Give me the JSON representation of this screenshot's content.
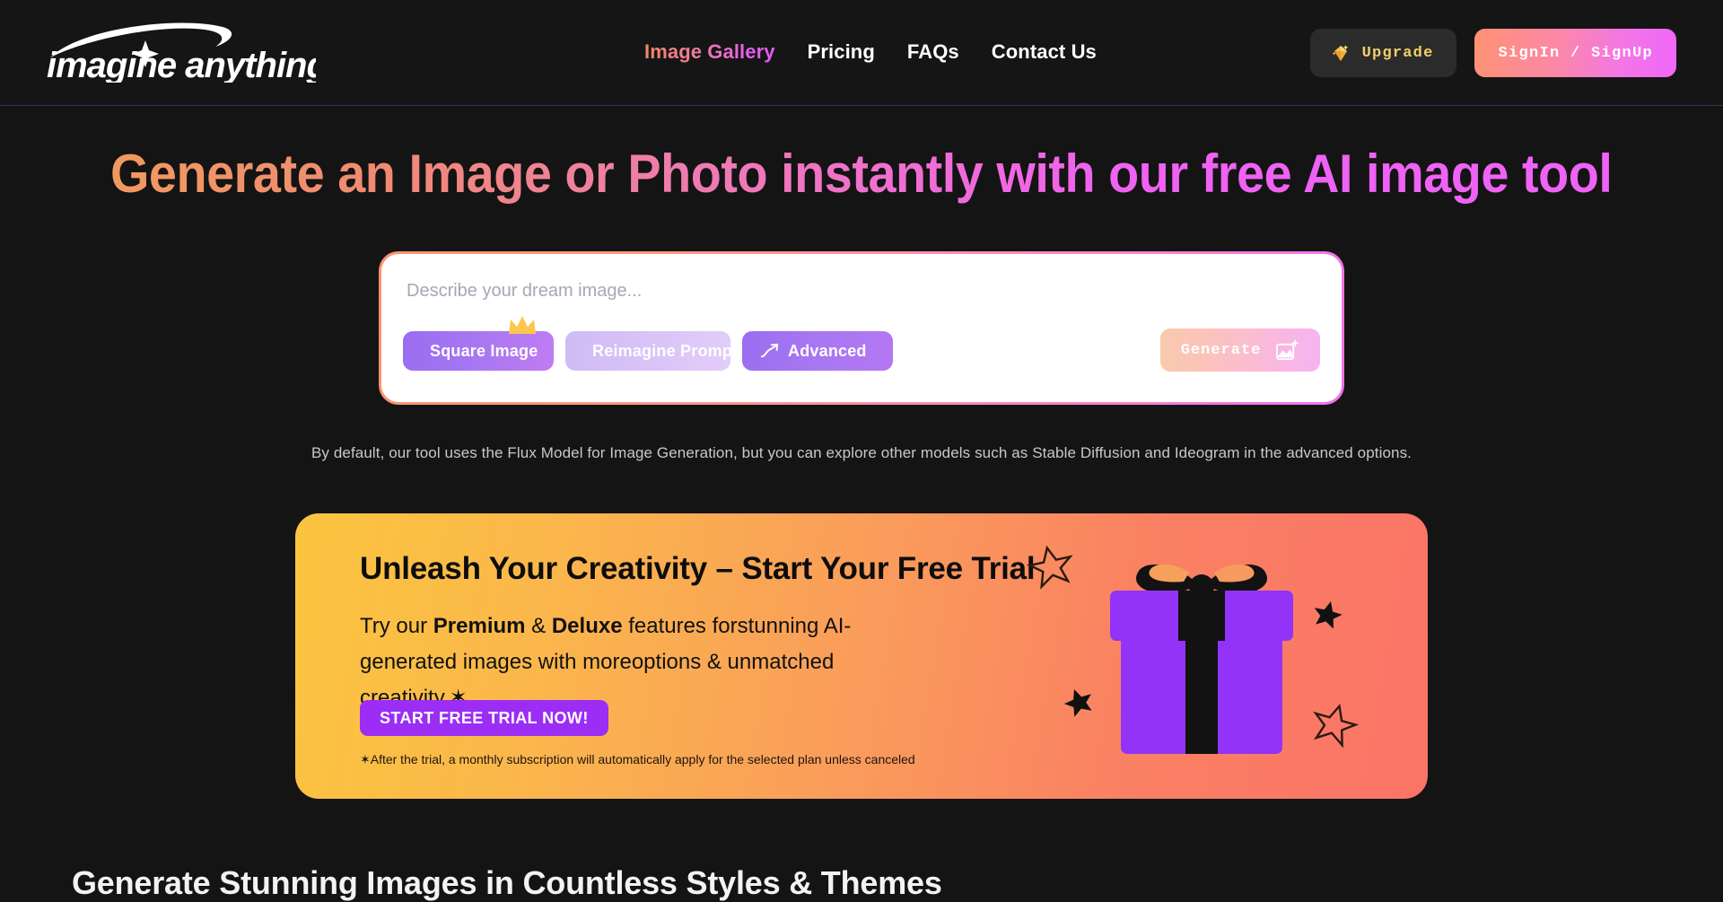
{
  "brand": {
    "name": "imagine anything",
    "logo_icon": "sparkle-swoosh-icon"
  },
  "colors": {
    "page_bg": "#141414",
    "header_bg": "#151515",
    "header_border": "#33305a",
    "accent_orange": "#ff9070",
    "accent_magenta": "#ee63f6",
    "accent_purple": "#9b2df5",
    "gold": "#f4d06a",
    "promo_gradient_start": "#fbc53f",
    "promo_gradient_end": "#fb7467"
  },
  "header": {
    "nav": [
      {
        "label": "Image Gallery",
        "gradient": true
      },
      {
        "label": "Pricing",
        "gradient": false
      },
      {
        "label": "FAQs",
        "gradient": false
      },
      {
        "label": "Contact Us",
        "gradient": false
      }
    ],
    "upgrade_button": {
      "label": "Upgrade",
      "icon": "gem-icon"
    },
    "auth_button": {
      "label": "SignIn / SignUp"
    }
  },
  "hero": {
    "title": "Generate an Image or Photo instantly with our free AI image tool",
    "prompt": {
      "placeholder": "Describe your dream image...",
      "value": ""
    },
    "tools": [
      {
        "label": "Square Image",
        "icon": "square-icon",
        "badge": "crown-icon",
        "state": "active"
      },
      {
        "label": "Reimagine Prompt",
        "icon": "magic-wand-icon",
        "state": "muted"
      },
      {
        "label": "Advanced",
        "icon": "trending-up-icon",
        "state": "active"
      }
    ],
    "generate_button": {
      "label": "Generate",
      "icon": "image-sparkle-icon",
      "state": "disabled"
    },
    "model_note": "By default, our tool uses the Flux Model for Image Generation, but you can explore other models such as Stable Diffusion and Ideogram in the advanced options."
  },
  "promo": {
    "heading": "Unleash Your Creativity – Start Your Free Trial",
    "body_prefix": "Try our ",
    "body_bold_1": "Premium",
    "body_mid": " & ",
    "body_bold_2": "Deluxe",
    "body_suffix": " features forstunning AI-generated images with moreoptions & unmatched creativity.✶",
    "cta_label": "START FREE TRIAL NOW!",
    "fineprint": "✶After the trial, a monthly subscription will automatically apply for the selected plan unless canceled",
    "illustration": "gift-box-icon"
  },
  "section": {
    "title": "Generate Stunning Images in Countless Styles & Themes"
  }
}
